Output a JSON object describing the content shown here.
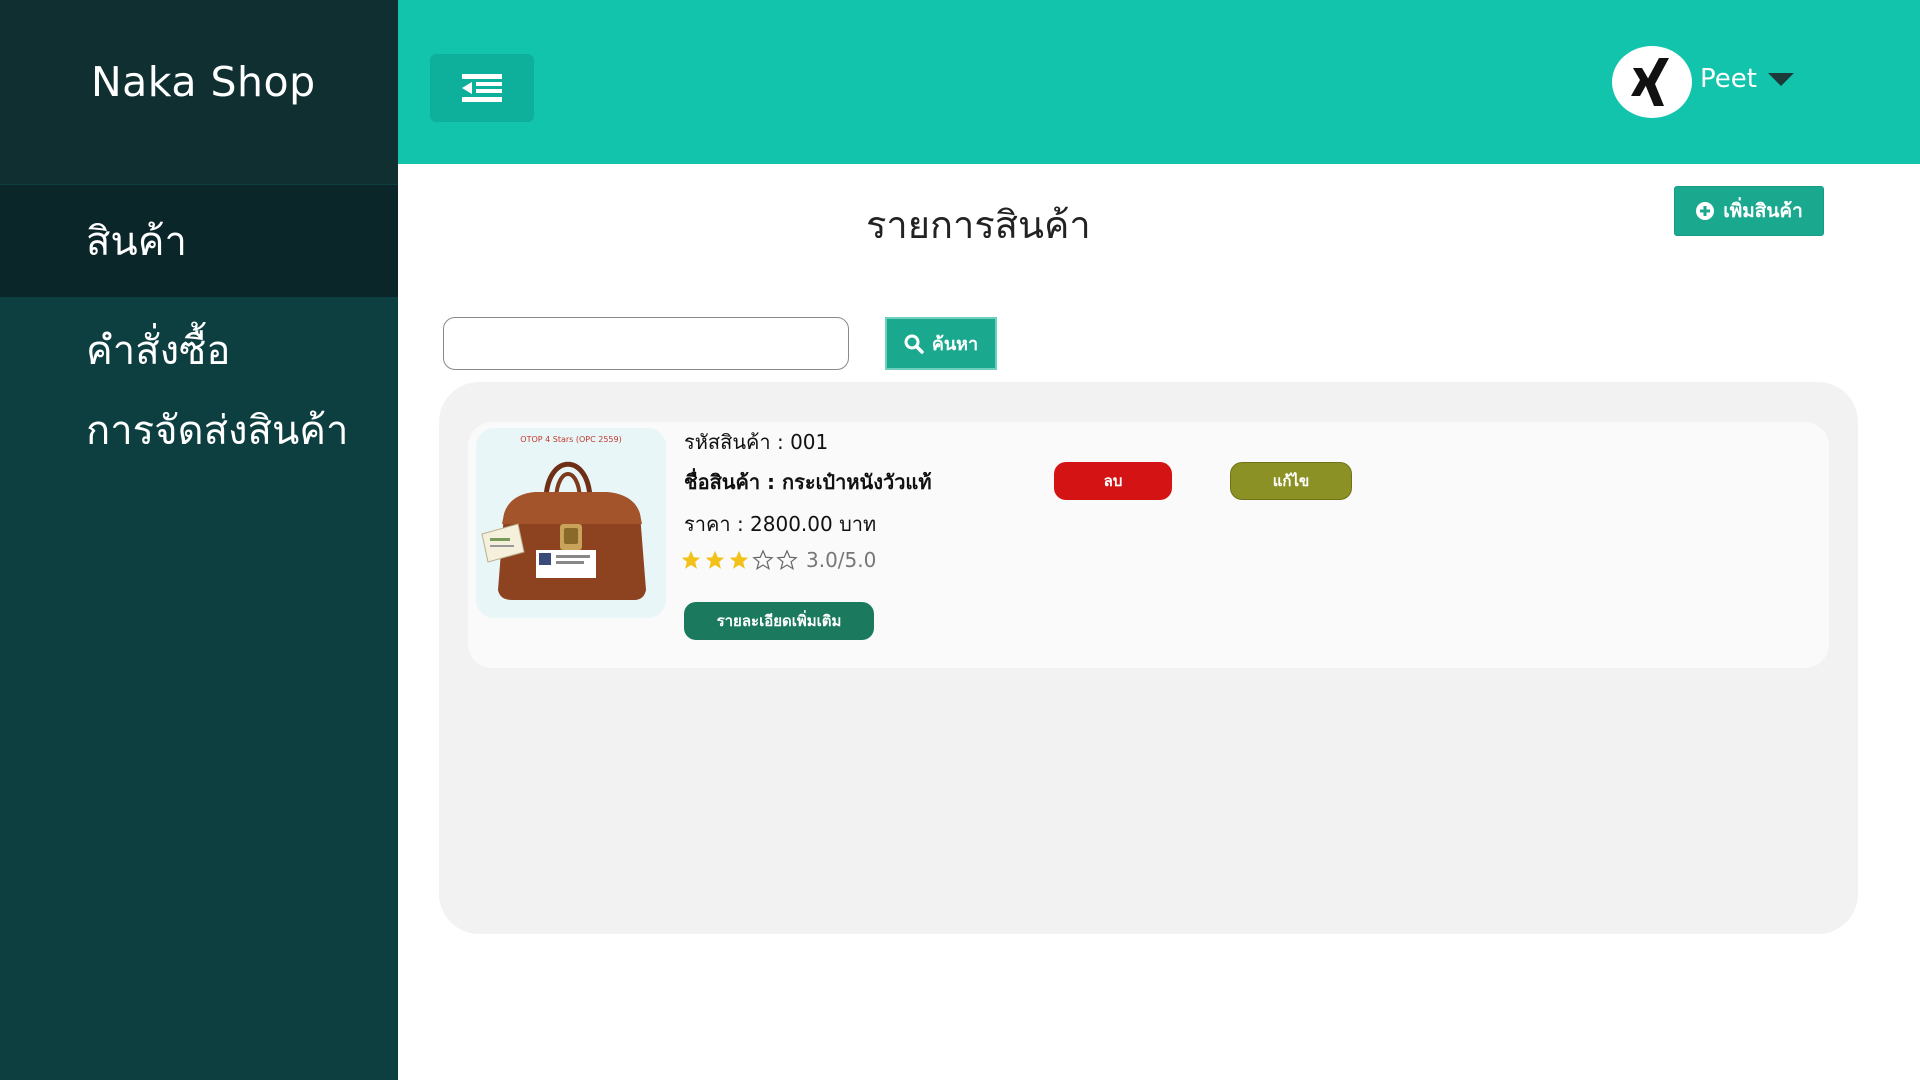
{
  "sidebar": {
    "brand": "Naka Shop",
    "items": [
      {
        "label": "สินค้า",
        "active": true
      },
      {
        "label": "คำสั่งซื้อ",
        "active": false
      },
      {
        "label": "การจัดส่งสินค้า",
        "active": false
      }
    ]
  },
  "topbar": {
    "menu_icon": "menu-collapse-icon",
    "user": {
      "name": "Peet",
      "avatar_icon": "xing-logo-icon"
    }
  },
  "main": {
    "title": "รายการสินค้า",
    "add_button": "เพิ่มสินค้า",
    "search": {
      "value": "",
      "placeholder": "",
      "button": "ค้นหา"
    },
    "products": [
      {
        "code_line": "รหัสสินค้า : 001",
        "name_line": "ชื่อสินค้า : กระเป๋าหนังวัวแท้",
        "price_line": "ราคา : 2800.00  บาท",
        "rating": 3,
        "rating_max": 5,
        "rating_text": "3.0/5.0",
        "image_caption": "OTOP 4 Stars (OPC 2559)",
        "delete_label": "ลบ",
        "edit_label": "แก้ไข",
        "detail_label": "รายละเอียดเพิ่มเติม"
      }
    ]
  },
  "colors": {
    "sidebar": "#0e3f40",
    "brand_bg": "#0f2f30",
    "topbar": "#13c4ac",
    "primary_button": "#1aa88e",
    "delete": "#d41414",
    "edit": "#8c9126",
    "detail": "#1b7a5e",
    "star": "#f2c21b"
  }
}
